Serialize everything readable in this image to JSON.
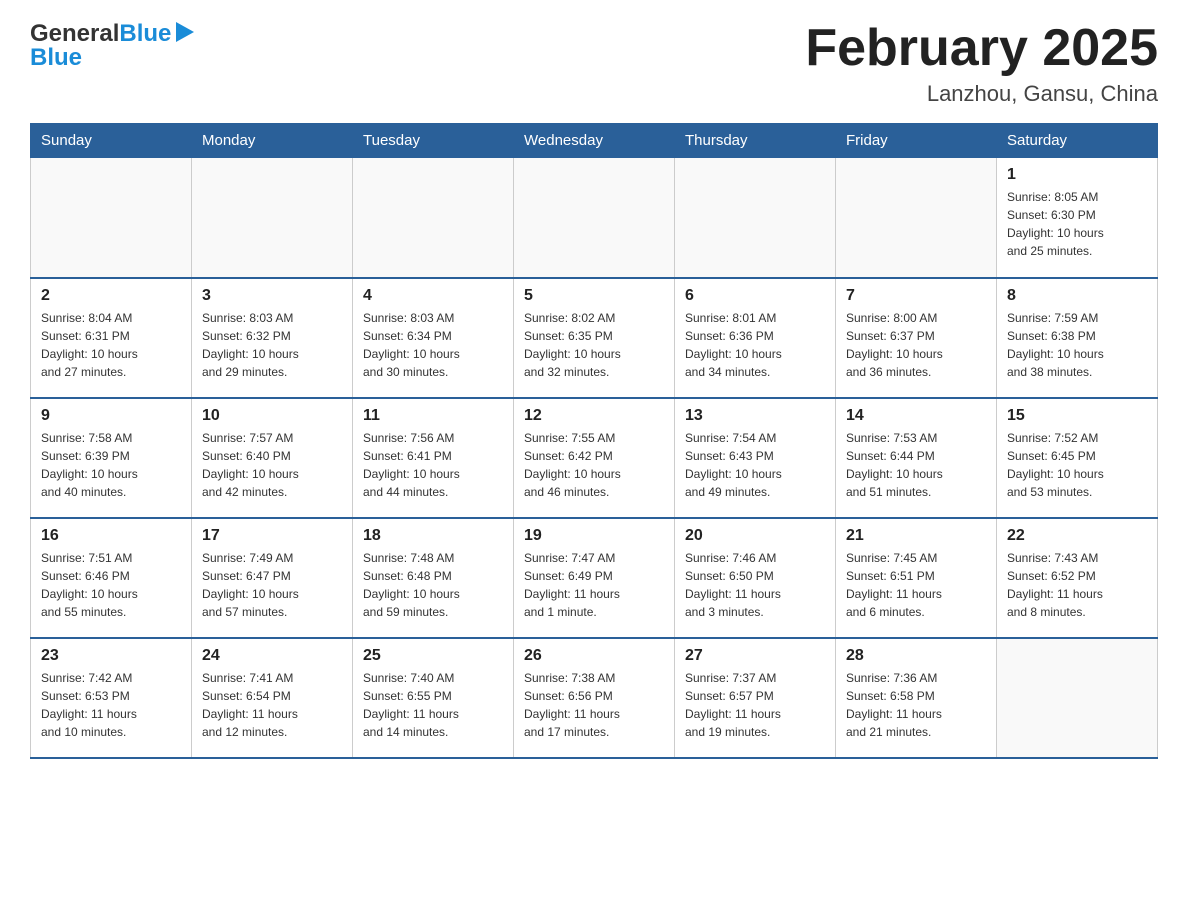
{
  "header": {
    "logo_general": "General",
    "logo_blue": "Blue",
    "month_title": "February 2025",
    "location": "Lanzhou, Gansu, China"
  },
  "weekdays": [
    "Sunday",
    "Monday",
    "Tuesday",
    "Wednesday",
    "Thursday",
    "Friday",
    "Saturday"
  ],
  "weeks": [
    [
      {
        "day": "",
        "info": ""
      },
      {
        "day": "",
        "info": ""
      },
      {
        "day": "",
        "info": ""
      },
      {
        "day": "",
        "info": ""
      },
      {
        "day": "",
        "info": ""
      },
      {
        "day": "",
        "info": ""
      },
      {
        "day": "1",
        "info": "Sunrise: 8:05 AM\nSunset: 6:30 PM\nDaylight: 10 hours\nand 25 minutes."
      }
    ],
    [
      {
        "day": "2",
        "info": "Sunrise: 8:04 AM\nSunset: 6:31 PM\nDaylight: 10 hours\nand 27 minutes."
      },
      {
        "day": "3",
        "info": "Sunrise: 8:03 AM\nSunset: 6:32 PM\nDaylight: 10 hours\nand 29 minutes."
      },
      {
        "day": "4",
        "info": "Sunrise: 8:03 AM\nSunset: 6:34 PM\nDaylight: 10 hours\nand 30 minutes."
      },
      {
        "day": "5",
        "info": "Sunrise: 8:02 AM\nSunset: 6:35 PM\nDaylight: 10 hours\nand 32 minutes."
      },
      {
        "day": "6",
        "info": "Sunrise: 8:01 AM\nSunset: 6:36 PM\nDaylight: 10 hours\nand 34 minutes."
      },
      {
        "day": "7",
        "info": "Sunrise: 8:00 AM\nSunset: 6:37 PM\nDaylight: 10 hours\nand 36 minutes."
      },
      {
        "day": "8",
        "info": "Sunrise: 7:59 AM\nSunset: 6:38 PM\nDaylight: 10 hours\nand 38 minutes."
      }
    ],
    [
      {
        "day": "9",
        "info": "Sunrise: 7:58 AM\nSunset: 6:39 PM\nDaylight: 10 hours\nand 40 minutes."
      },
      {
        "day": "10",
        "info": "Sunrise: 7:57 AM\nSunset: 6:40 PM\nDaylight: 10 hours\nand 42 minutes."
      },
      {
        "day": "11",
        "info": "Sunrise: 7:56 AM\nSunset: 6:41 PM\nDaylight: 10 hours\nand 44 minutes."
      },
      {
        "day": "12",
        "info": "Sunrise: 7:55 AM\nSunset: 6:42 PM\nDaylight: 10 hours\nand 46 minutes."
      },
      {
        "day": "13",
        "info": "Sunrise: 7:54 AM\nSunset: 6:43 PM\nDaylight: 10 hours\nand 49 minutes."
      },
      {
        "day": "14",
        "info": "Sunrise: 7:53 AM\nSunset: 6:44 PM\nDaylight: 10 hours\nand 51 minutes."
      },
      {
        "day": "15",
        "info": "Sunrise: 7:52 AM\nSunset: 6:45 PM\nDaylight: 10 hours\nand 53 minutes."
      }
    ],
    [
      {
        "day": "16",
        "info": "Sunrise: 7:51 AM\nSunset: 6:46 PM\nDaylight: 10 hours\nand 55 minutes."
      },
      {
        "day": "17",
        "info": "Sunrise: 7:49 AM\nSunset: 6:47 PM\nDaylight: 10 hours\nand 57 minutes."
      },
      {
        "day": "18",
        "info": "Sunrise: 7:48 AM\nSunset: 6:48 PM\nDaylight: 10 hours\nand 59 minutes."
      },
      {
        "day": "19",
        "info": "Sunrise: 7:47 AM\nSunset: 6:49 PM\nDaylight: 11 hours\nand 1 minute."
      },
      {
        "day": "20",
        "info": "Sunrise: 7:46 AM\nSunset: 6:50 PM\nDaylight: 11 hours\nand 3 minutes."
      },
      {
        "day": "21",
        "info": "Sunrise: 7:45 AM\nSunset: 6:51 PM\nDaylight: 11 hours\nand 6 minutes."
      },
      {
        "day": "22",
        "info": "Sunrise: 7:43 AM\nSunset: 6:52 PM\nDaylight: 11 hours\nand 8 minutes."
      }
    ],
    [
      {
        "day": "23",
        "info": "Sunrise: 7:42 AM\nSunset: 6:53 PM\nDaylight: 11 hours\nand 10 minutes."
      },
      {
        "day": "24",
        "info": "Sunrise: 7:41 AM\nSunset: 6:54 PM\nDaylight: 11 hours\nand 12 minutes."
      },
      {
        "day": "25",
        "info": "Sunrise: 7:40 AM\nSunset: 6:55 PM\nDaylight: 11 hours\nand 14 minutes."
      },
      {
        "day": "26",
        "info": "Sunrise: 7:38 AM\nSunset: 6:56 PM\nDaylight: 11 hours\nand 17 minutes."
      },
      {
        "day": "27",
        "info": "Sunrise: 7:37 AM\nSunset: 6:57 PM\nDaylight: 11 hours\nand 19 minutes."
      },
      {
        "day": "28",
        "info": "Sunrise: 7:36 AM\nSunset: 6:58 PM\nDaylight: 11 hours\nand 21 minutes."
      },
      {
        "day": "",
        "info": ""
      }
    ]
  ]
}
